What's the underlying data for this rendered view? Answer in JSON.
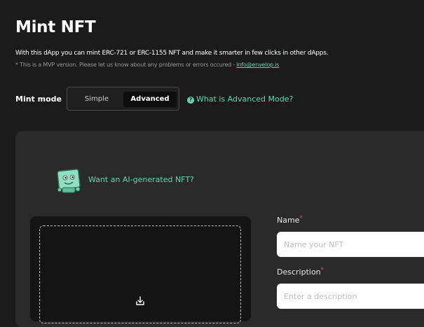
{
  "page": {
    "title": "Mint NFT",
    "intro": "With this dApp you can mint ERC-721 or ERC-1155 NFT and make it smarter in few clicks in other dApps.",
    "note_prefix": "* This is a MVP version. Please let us know about any problems or errors occured - ",
    "note_email": "info@envelop.is"
  },
  "mint_mode": {
    "label": "Mint mode",
    "options": [
      "Simple",
      "Advanced"
    ],
    "selected": "Advanced",
    "help_icon": "question-circle-icon",
    "help_link": "What is Advanced Mode?"
  },
  "ai_promo": {
    "icon": "robot-mascot-icon",
    "text": "Want an AI-generated NFT?"
  },
  "upload": {
    "icon": "download-tray-icon"
  },
  "form": {
    "name": {
      "label": "Name",
      "required_mark": "*",
      "placeholder": "Name your NFT",
      "value": ""
    },
    "description": {
      "label": "Description",
      "required_mark": "*",
      "placeholder": "Enter a description",
      "value": ""
    }
  },
  "colors": {
    "background": "#1b1b1b",
    "panel": "#2a2a2a",
    "accent": "#5fd9b0",
    "required": "#e0564d"
  }
}
